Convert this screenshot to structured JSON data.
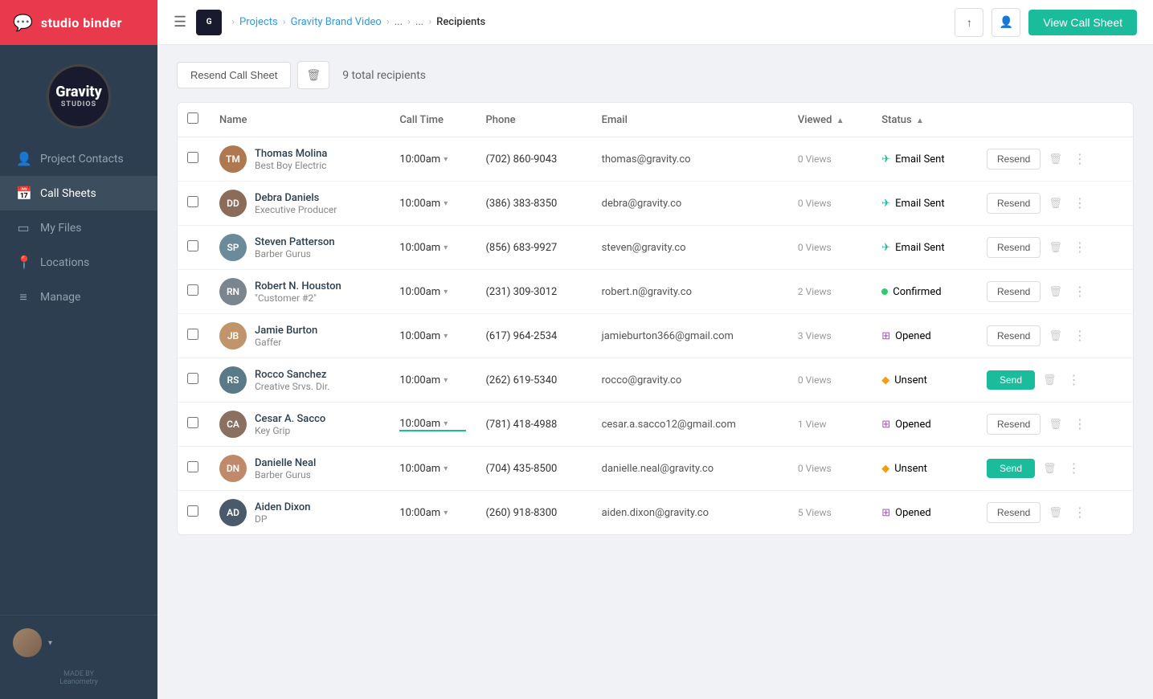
{
  "brand": {
    "name": "studio binder",
    "icon": "💬"
  },
  "project": {
    "name": "Gravity",
    "subtitle": "STUDIOS"
  },
  "sidebar": {
    "items": [
      {
        "id": "project-contacts",
        "label": "Project Contacts",
        "icon": "👤",
        "active": false
      },
      {
        "id": "call-sheets",
        "label": "Call Sheets",
        "icon": "📅",
        "active": true
      },
      {
        "id": "my-files",
        "label": "My Files",
        "icon": "▭",
        "active": false
      },
      {
        "id": "locations",
        "label": "Locations",
        "icon": "📍",
        "active": false
      },
      {
        "id": "manage",
        "label": "Manage",
        "icon": "≡",
        "active": false
      }
    ],
    "made_by": "MADE BY\nLeanometry"
  },
  "topbar": {
    "breadcrumb": {
      "projects_label": "Projects",
      "project_label": "Gravity Brand Video",
      "ellipsis1": "...",
      "ellipsis2": "...",
      "current": "Recipients"
    },
    "view_call_sheet_btn": "View Call Sheet"
  },
  "toolbar": {
    "resend_label": "Resend Call Sheet",
    "total_count": "9 total recipients"
  },
  "table": {
    "columns": [
      {
        "id": "name",
        "label": "Name"
      },
      {
        "id": "call_time",
        "label": "Call Time"
      },
      {
        "id": "phone",
        "label": "Phone"
      },
      {
        "id": "email",
        "label": "Email"
      },
      {
        "id": "viewed",
        "label": "Viewed",
        "sort": "asc"
      },
      {
        "id": "status",
        "label": "Status",
        "sort": "asc"
      }
    ],
    "rows": [
      {
        "id": 1,
        "name": "Thomas Molina",
        "role": "Best Boy Electric",
        "call_time": "10:00am",
        "phone": "(702) 860-9043",
        "email": "thomas@gravity.co",
        "views": "0 Views",
        "status": "Email Sent",
        "status_type": "sent",
        "action": "resend",
        "avatar_color": "#b07850"
      },
      {
        "id": 2,
        "name": "Debra Daniels",
        "role": "Executive Producer",
        "call_time": "10:00am",
        "phone": "(386) 383-8350",
        "email": "debra@gravity.co",
        "views": "0 Views",
        "status": "Email Sent",
        "status_type": "sent",
        "action": "resend",
        "avatar_color": "#8b6b5a"
      },
      {
        "id": 3,
        "name": "Steven Patterson",
        "role": "Barber Gurus",
        "call_time": "10:00am",
        "phone": "(856) 683-9927",
        "email": "steven@gravity.co",
        "views": "0 Views",
        "status": "Email Sent",
        "status_type": "sent",
        "action": "resend",
        "avatar_color": "#6b8a9a"
      },
      {
        "id": 4,
        "name": "Robert N. Houston",
        "role": "\"Customer #2\"",
        "call_time": "10:00am",
        "phone": "(231) 309-3012",
        "email": "robert.n@gravity.co",
        "views": "2 Views",
        "status": "Confirmed",
        "status_type": "confirmed",
        "action": "resend",
        "avatar_color": "#7a8590"
      },
      {
        "id": 5,
        "name": "Jamie Burton",
        "role": "Gaffer",
        "call_time": "10:00am",
        "phone": "(617) 964-2534",
        "email": "jamieburton366@gmail.com",
        "views": "3 Views",
        "status": "Opened",
        "status_type": "opened",
        "action": "resend",
        "avatar_color": "#c0956b"
      },
      {
        "id": 6,
        "name": "Rocco Sanchez",
        "role": "Creative Srvs. Dir.",
        "call_time": "10:00am",
        "phone": "(262) 619-5340",
        "email": "rocco@gravity.co",
        "views": "0 Views",
        "status": "Unsent",
        "status_type": "unsent",
        "action": "send",
        "avatar_color": "#5a7a8a"
      },
      {
        "id": 7,
        "name": "Cesar A. Sacco",
        "role": "Key Grip",
        "call_time": "10:00am",
        "phone": "(781) 418-4988",
        "email": "cesar.a.sacco12@gmail.com",
        "views": "1 View",
        "status": "Opened",
        "status_type": "opened",
        "action": "resend",
        "avatar_color": "#8a7060",
        "time_active": true
      },
      {
        "id": 8,
        "name": "Danielle Neal",
        "role": "Barber Gurus",
        "call_time": "10:00am",
        "phone": "(704) 435-8500",
        "email": "danielle.neal@gravity.co",
        "views": "0 Views",
        "status": "Unsent",
        "status_type": "unsent",
        "action": "send",
        "avatar_color": "#c08a6a"
      },
      {
        "id": 9,
        "name": "Aiden Dixon",
        "role": "DP",
        "call_time": "10:00am",
        "phone": "(260) 918-8300",
        "email": "aiden.dixon@gravity.co",
        "views": "5 Views",
        "status": "Opened",
        "status_type": "opened",
        "action": "resend",
        "avatar_color": "#4a5a6a"
      }
    ]
  }
}
